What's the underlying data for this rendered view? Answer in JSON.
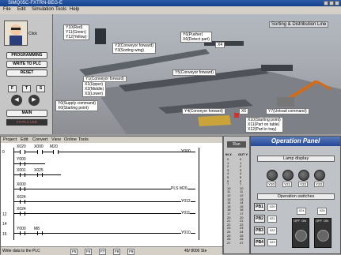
{
  "window": {
    "title": "SIMQ05C-FXTRN-BEG-E"
  },
  "menu": [
    "File",
    "Edit",
    "Simulation",
    "Tools",
    "Help"
  ],
  "scene": {
    "title": "Sorting & Distribution Line",
    "labels": {
      "y10": [
        "Y10(Red)",
        "Y11(Green)",
        "Y12(Yellow)"
      ],
      "y2": [
        "Y2(Conveyor forward)",
        "Y3(Sorting wing)"
      ],
      "y6": [
        "Y6(Pusher)",
        "X6(Detect part)"
      ],
      "x4": "X4",
      "y1": "Y1(Conveyor forward)",
      "x123": [
        "X1(Upper)",
        "X2(Middle)",
        "X3(Lower)"
      ],
      "y0": [
        "Y0(Supply command)",
        "X0(Starting point)"
      ],
      "y5": "Y5(Conveyor forward)",
      "y4": "Y4(Conveyor forward)",
      "x5": "X5",
      "y7": "Y7(Unload command)",
      "x10": [
        "X10(Starting point)",
        "X11(Part on table)",
        "X12(Part in tray)"
      ]
    }
  },
  "control": {
    "click": "Click",
    "programming": "PROGRAMMING",
    "write": "WRITE TO PLC",
    "reset": "RESET",
    "fkeys": [
      "F",
      "T",
      "S"
    ],
    "main": "MAIN",
    "status": "FX-PLC LED"
  },
  "ladder": {
    "menu": [
      "Project",
      "Edit",
      "Convert",
      "View",
      "Online",
      "Tools"
    ],
    "rows": [
      {
        "num": "0",
        "contacts": [
          "X020",
          "X000",
          "M20"
        ],
        "coil": "Y000"
      },
      {
        "num": "",
        "contacts": [
          "Y000"
        ],
        "coil": ""
      },
      {
        "num": "",
        "contacts": [
          "X001",
          "X025"
        ],
        "coil": ""
      },
      {
        "num": "",
        "contacts": [
          "X000"
        ],
        "coil": "PLS  M20"
      },
      {
        "num": "",
        "contacts": [
          "X024"
        ],
        "coil": "Y012"
      },
      {
        "num": "12",
        "contacts": [
          "X024"
        ],
        "coil": "Y011"
      },
      {
        "num": "14",
        "contacts": [],
        "coil": ""
      },
      {
        "num": "16",
        "contacts": [
          "Y000",
          "M8"
        ],
        "coil": "Y010"
      }
    ],
    "status_left": "Write data to the PLC",
    "status_right": "45/ 8000 Ste",
    "tools": [
      "F5",
      "F6",
      "F7",
      "F8",
      "F9"
    ]
  },
  "io": {
    "run": "Run",
    "in_head": "IN X",
    "out_head": "OUT Y",
    "rows": [
      "0",
      "1",
      "2",
      "3",
      "4",
      "5",
      "6",
      "7",
      "10",
      "11",
      "12",
      "13",
      "14",
      "15",
      "16",
      "17",
      "20",
      "21",
      "22",
      "23",
      "24",
      "25",
      "26",
      "27"
    ]
  },
  "panel": {
    "title": "Operation Panel",
    "lamp_title": "Lamp display",
    "lamps": [
      "Y20",
      "Y21",
      "Y22",
      "Y23"
    ],
    "switch_title": "Operation switches",
    "pbs": [
      {
        "label": "PB1",
        "addr": "X20"
      },
      {
        "label": "PB2",
        "addr": "X21"
      },
      {
        "label": "PB3",
        "addr": "X22"
      },
      {
        "label": "PB4",
        "addr": "X23"
      }
    ],
    "sw_addr": [
      "X24",
      "X25"
    ],
    "sw_states": [
      "OFF",
      "ON"
    ]
  },
  "colors": {
    "accent": "#24479a",
    "scene_bg": "#a9acb2"
  }
}
